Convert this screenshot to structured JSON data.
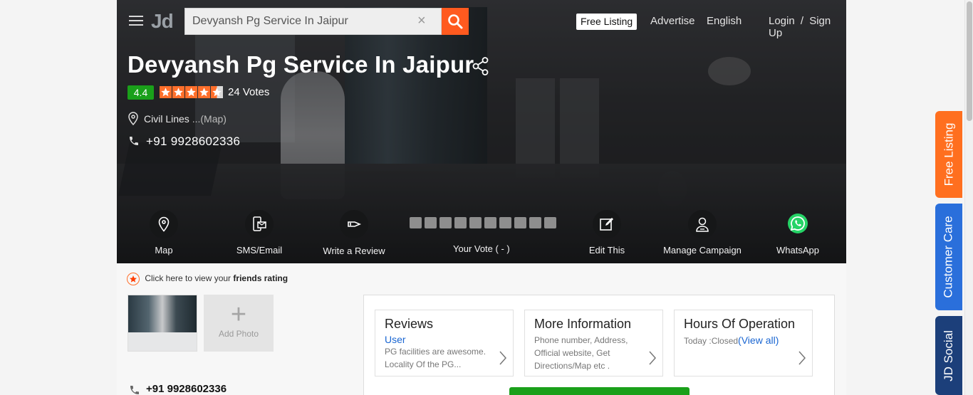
{
  "search": {
    "value": "Devyansh Pg Service In Jaipur",
    "clear": "×"
  },
  "header": {
    "logo": "Jd",
    "free_listing": "Free Listing",
    "advertise": "Advertise",
    "language": "English",
    "login": "Login",
    "separator": "/",
    "signup": "Sign Up"
  },
  "listing": {
    "title": "Devyansh Pg Service In Jaipur",
    "rating": "4.4",
    "stars_value": 4.5,
    "votes": "24 Votes",
    "location": "Civil Lines",
    "map_link": "...(Map)",
    "phone": "+91 9928602336"
  },
  "actions": [
    {
      "label": "Map",
      "icon": "map-pin-icon"
    },
    {
      "label": "SMS/Email",
      "icon": "sms-email-icon"
    },
    {
      "label": "Write a Review",
      "icon": "review-pen-icon"
    },
    {
      "label": "Your Vote ( - )",
      "icon": "vote-boxes"
    },
    {
      "label": "Edit This",
      "icon": "edit-icon"
    },
    {
      "label": "Manage Campaign",
      "icon": "user-campaign-icon"
    },
    {
      "label": "WhatsApp",
      "icon": "whatsapp-icon"
    }
  ],
  "friends": {
    "prefix": "Click here to view your",
    "bold": "friends rating"
  },
  "photos": {
    "add_label": "Add Photo",
    "add_symbol": "+"
  },
  "cards": [
    {
      "title": "Reviews",
      "sub": "User",
      "text": "PG facilities are awesome. Locality Of the PG..."
    },
    {
      "title": "More Information",
      "sub": "",
      "text": "Phone number, Address, Official website, Get Directions/Map etc ."
    },
    {
      "title": "Hours Of Operation",
      "sub": "",
      "text_prefix": "Today :Closed",
      "text_link": "(View all)"
    }
  ],
  "bottom_phone": "+91 9928602336",
  "side_tabs": {
    "free": "Free Listing",
    "care": "Customer Care",
    "social": "JD Social"
  },
  "colors": {
    "accent": "#ff5a1f",
    "rating_green": "#1aa01a",
    "star_orange": "#ff6f2b",
    "link_blue": "#1a66d2",
    "care_blue": "#2a6fdb",
    "social_navy": "#1c3f7a"
  }
}
